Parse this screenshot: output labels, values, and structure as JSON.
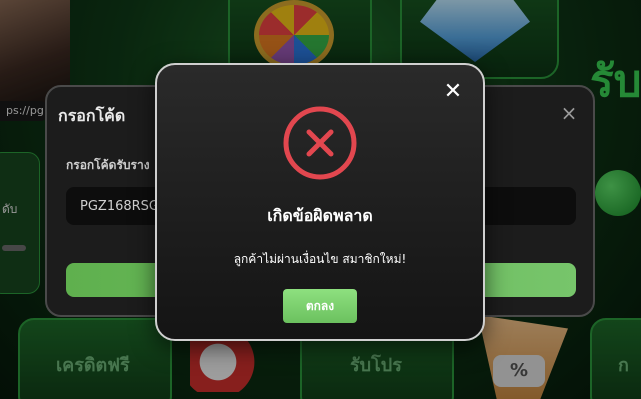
{
  "background": {
    "url_fragment": "ps://pg",
    "side_text": "รับ",
    "bottom_tiles": [
      "เครดิตฟรี",
      "รับโปร",
      "ก"
    ],
    "left_card_text": "ดับ",
    "percent_icon": "%"
  },
  "code_modal": {
    "title": "กรอกโค้ด",
    "close_icon": "×",
    "field_label": "กรอกโค้ดรับราง",
    "field_value": "PGZ168RSG"
  },
  "error_modal": {
    "close_icon": "✕",
    "icon": "error-x-circle-icon",
    "title": "เกิดข้อผิดพลาด",
    "message": "ลูกค้าไม่ผ่านเงื่อนไข สมาชิกใหม่!",
    "ok_label": "ตกลง"
  },
  "colors": {
    "accent_green": "#6cc15f",
    "error_red": "#e2474f",
    "modal_bg": "#1c1c1c"
  }
}
